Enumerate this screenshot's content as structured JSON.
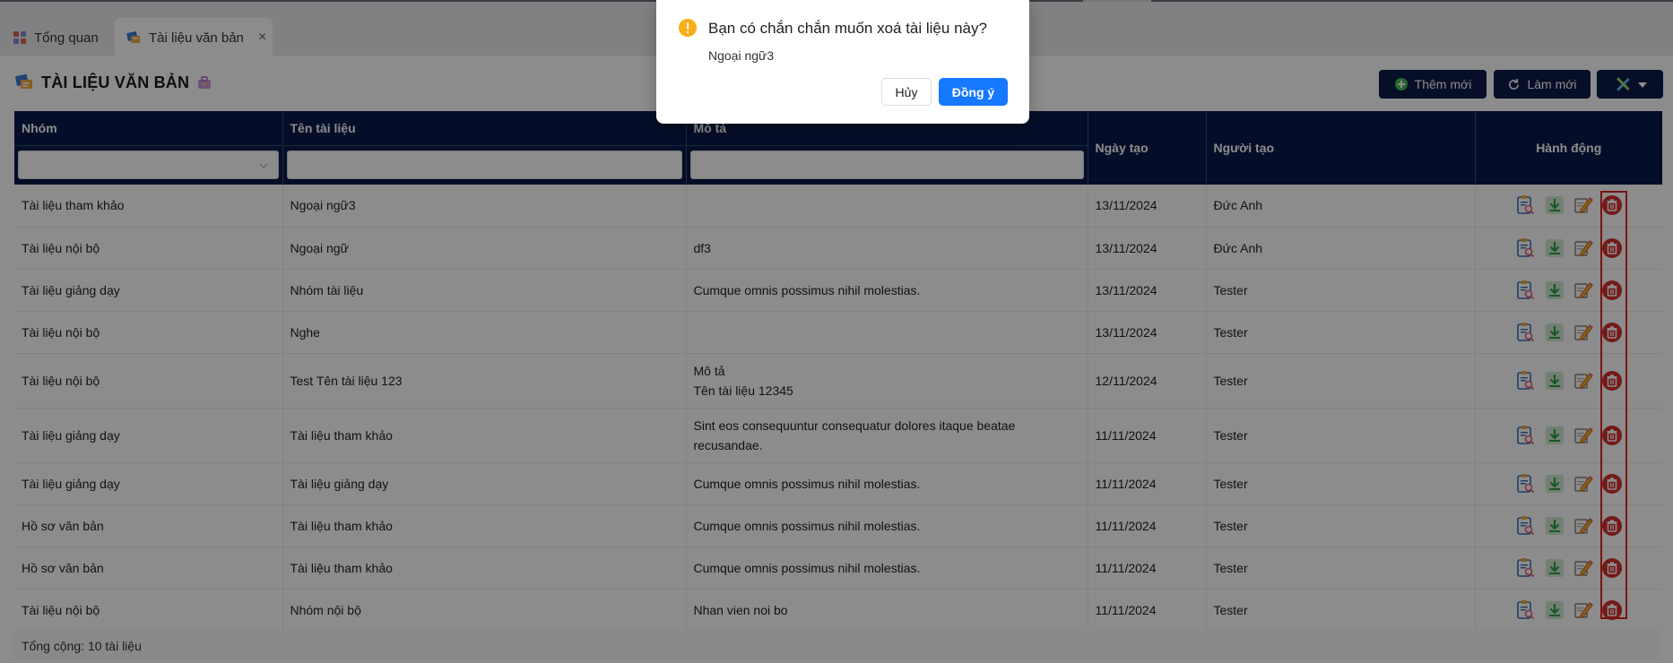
{
  "tabs": [
    {
      "label": "Tổng quan"
    },
    {
      "label": "Tài liệu văn bản",
      "active": true
    }
  ],
  "page": {
    "title": "TÀI LIỆU VĂN BẢN"
  },
  "toolbar": {
    "add_label": "Thêm mới",
    "refresh_label": "Làm mới"
  },
  "table": {
    "columns": [
      "Nhóm",
      "Tên tài liệu",
      "Mô tả",
      "Ngày tạo",
      "Người tạo",
      "Hành động"
    ],
    "rows": [
      {
        "group": "Tài liệu tham khảo",
        "name": "Ngoại ngữ3",
        "desc": "",
        "desc2": "",
        "date": "13/11/2024",
        "creator": "Đức Anh"
      },
      {
        "group": "Tài liệu nội bộ",
        "name": "Ngoại ngữ",
        "desc": "df3",
        "desc2": "",
        "date": "13/11/2024",
        "creator": "Đức Anh"
      },
      {
        "group": "Tài liệu giảng dạy",
        "name": "Nhóm tài liệu",
        "desc": "Cumque omnis possimus nihil molestias.",
        "desc2": "",
        "date": "13/11/2024",
        "creator": "Tester"
      },
      {
        "group": "Tài liệu nội bộ",
        "name": "Nghe",
        "desc": "",
        "desc2": "",
        "date": "13/11/2024",
        "creator": "Tester"
      },
      {
        "group": "Tài liệu nội bộ",
        "name": "Test Tên tài liệu 123",
        "desc": "Mô tả",
        "desc2": "Tên tài liệu 12345",
        "date": "12/11/2024",
        "creator": "Tester"
      },
      {
        "group": "Tài liệu giảng dạy",
        "name": "Tài liệu tham khảo",
        "desc": "Sint eos consequuntur consequatur dolores itaque beatae",
        "desc2": "recusandae.",
        "date": "11/11/2024",
        "creator": "Tester"
      },
      {
        "group": "Tài liệu giảng dạy",
        "name": "Tài liệu giảng dạy",
        "desc": "Cumque omnis possimus nihil molestias.",
        "desc2": "",
        "date": "11/11/2024",
        "creator": "Tester"
      },
      {
        "group": "Hồ sơ văn bản",
        "name": "Tài liệu tham khảo",
        "desc": "Cumque omnis possimus nihil molestias.",
        "desc2": "",
        "date": "11/11/2024",
        "creator": "Tester"
      },
      {
        "group": "Hồ sơ văn bản",
        "name": "Tài liệu tham khảo",
        "desc": "Cumque omnis possimus nihil molestias.",
        "desc2": "",
        "date": "11/11/2024",
        "creator": "Tester"
      },
      {
        "group": "Tài liệu nội bộ",
        "name": "Nhóm nội bộ",
        "desc": "Nhan vien noi bo",
        "desc2": "",
        "date": "11/11/2024",
        "creator": "Tester"
      }
    ]
  },
  "footer": {
    "total": "Tổng cộng: 10 tài liệu"
  },
  "dialog": {
    "title": "Bạn có chắn chắn muốn xoá tài liệu này?",
    "description": "Ngoại ngữ3",
    "cancel_label": "Hủy",
    "ok_label": "Đồng ý"
  },
  "colors": {
    "header_bg": "#0a1a4a",
    "primary": "#1677ff",
    "warning": "#faad14",
    "danger": "#d32f2f"
  }
}
